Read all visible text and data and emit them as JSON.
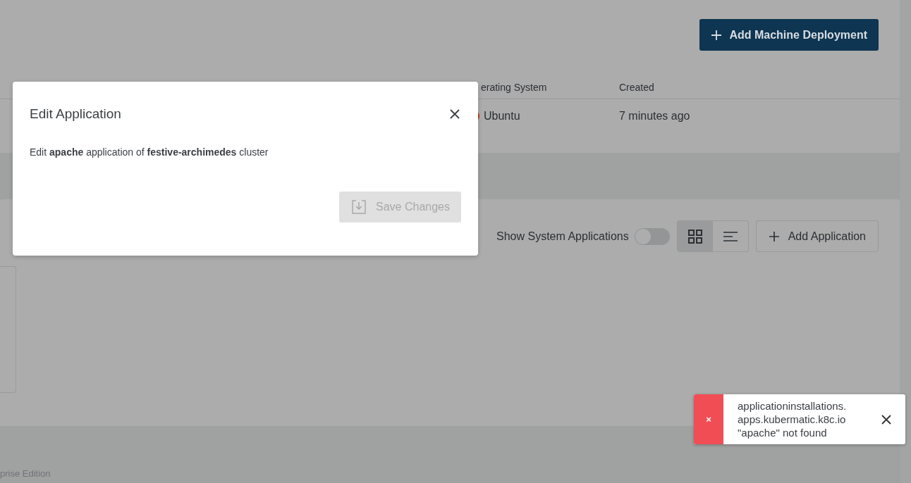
{
  "page": {
    "add_machine_deployment_button": "Add Machine Deployment",
    "table": {
      "columns": [
        "erating System",
        "Created"
      ],
      "rows": [
        {
          "operating_system": "Ubuntu",
          "created": "7 minutes ago"
        }
      ]
    },
    "applications_toolbar": {
      "show_system_applications": {
        "label": "Show System Applications",
        "on": false
      },
      "view_modes": [
        {
          "kind": "grid",
          "selected": true
        },
        {
          "kind": "list",
          "selected": false
        }
      ],
      "add_application_button": "Add Application"
    },
    "footer": "prise Edition"
  },
  "dialog": {
    "title": "Edit Application",
    "description": "Edit **apache** application of **festive-archimedes** cluster",
    "save_button": {
      "label": "Save Changes",
      "disabled": true
    }
  },
  "toast": {
    "icon": "×",
    "message": [
      "applicationinstallations.",
      "apps.kubermatic.k8c.io",
      "\"apache\" not found"
    ]
  }
}
